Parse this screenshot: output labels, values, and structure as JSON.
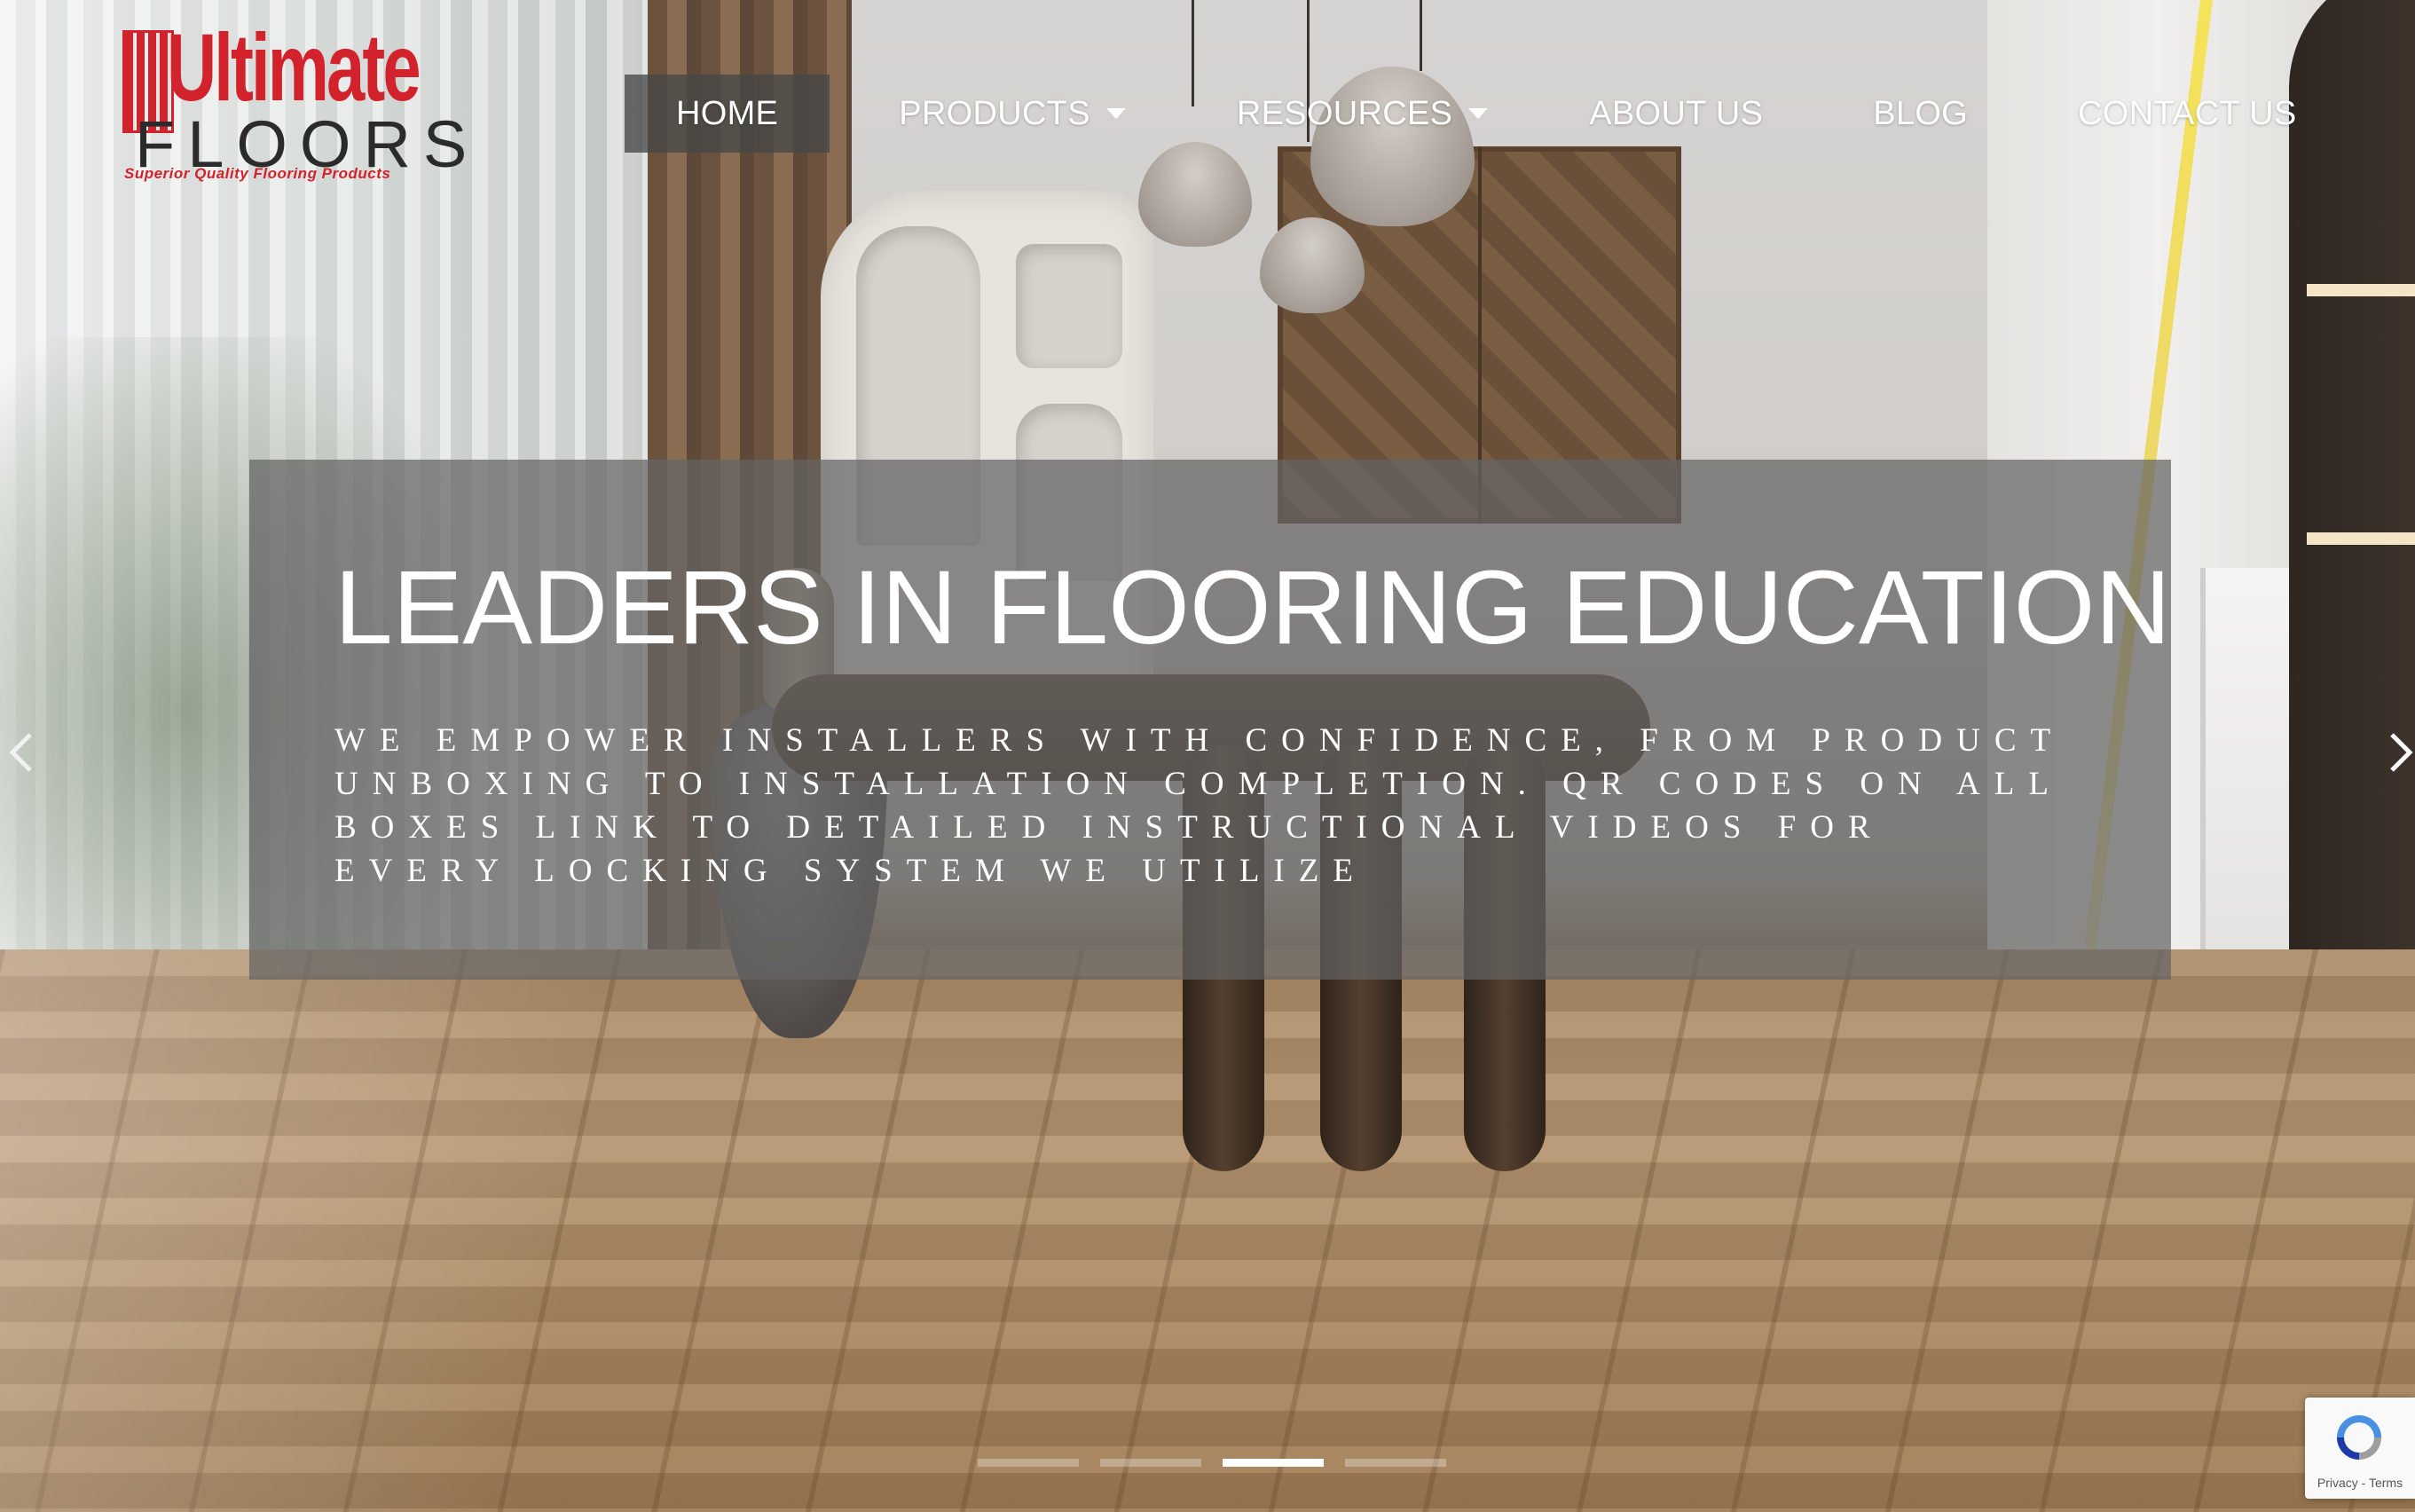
{
  "brand": {
    "name_main": "Ultimate",
    "name_sub": "FLOORS",
    "tagline": "Superior Quality Flooring Products",
    "color_red": "#d2222c"
  },
  "nav": {
    "items": [
      {
        "label": "HOME",
        "active": true,
        "has_dropdown": false
      },
      {
        "label": "PRODUCTS",
        "active": false,
        "has_dropdown": true
      },
      {
        "label": "RESOURCES",
        "active": false,
        "has_dropdown": true
      },
      {
        "label": "ABOUT US",
        "active": false,
        "has_dropdown": false
      },
      {
        "label": "BLOG",
        "active": false,
        "has_dropdown": false
      },
      {
        "label": "CONTACT US",
        "active": false,
        "has_dropdown": false
      }
    ]
  },
  "hero": {
    "headline": "LEADERS IN FLOORING EDUCATION",
    "body": "We empower installers with confidence, from product unboxing to installation completion. QR codes on all boxes link to detailed instructional videos for every locking system we utilize"
  },
  "slider": {
    "prev_icon": "chevron-left-icon",
    "next_icon": "chevron-right-icon",
    "total_slides": 4,
    "active_slide": 3
  },
  "recaptcha": {
    "text": "Privacy - Terms"
  }
}
